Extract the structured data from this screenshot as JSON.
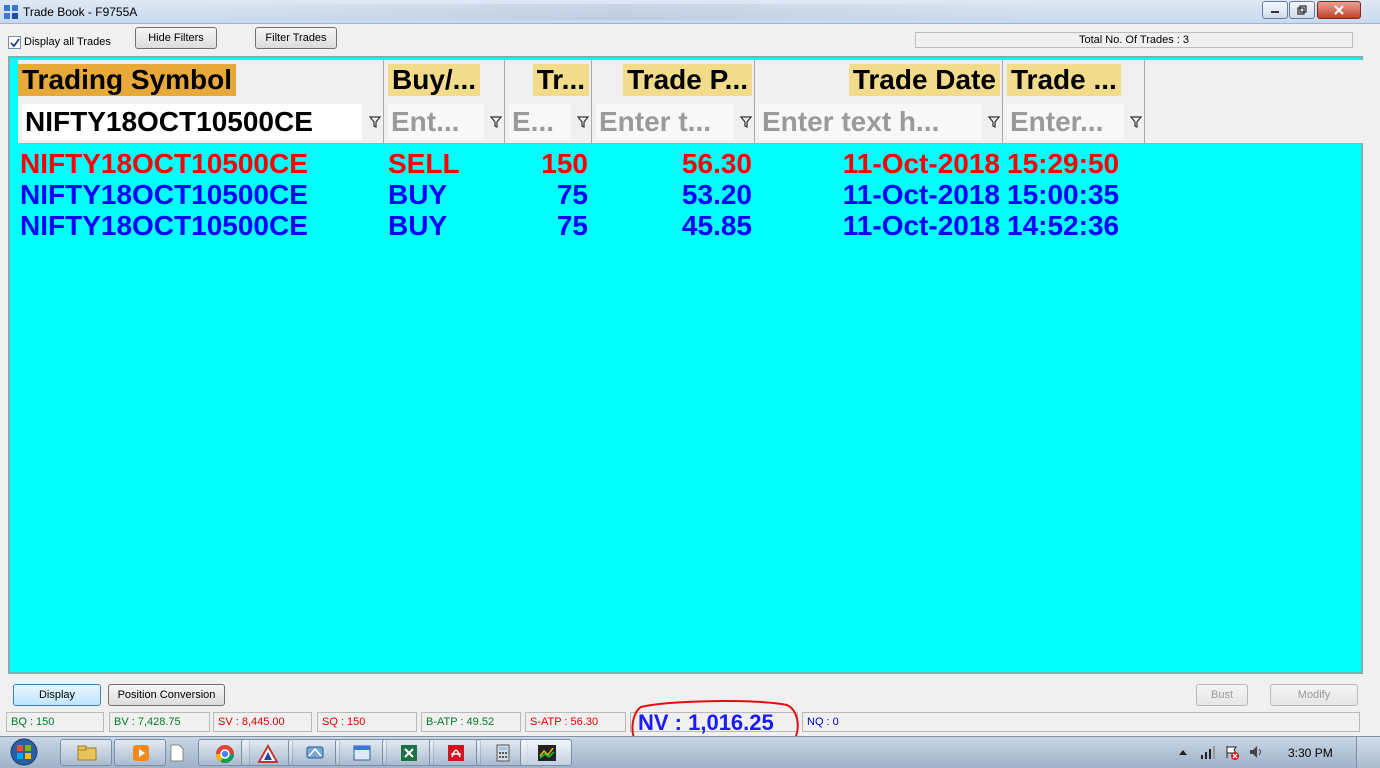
{
  "window": {
    "title": "Trade Book - F9755A"
  },
  "toolbar": {
    "display_all_label": "Display all Trades",
    "display_all_checked": true,
    "hide_filters_label": "Hide Filters",
    "filter_trades_label": "Filter Trades",
    "total_trades_text": "Total No. Of Trades : 3"
  },
  "grid": {
    "columns": [
      {
        "header": "Trading Symbol",
        "filter": "NIFTY18OCT10500CE",
        "filter_is_placeholder": false
      },
      {
        "header": "Buy/...",
        "filter": "Ent...",
        "filter_is_placeholder": true
      },
      {
        "header": "Tr...",
        "filter": "E...",
        "filter_is_placeholder": true
      },
      {
        "header": "Trade P...",
        "filter": "Enter t...",
        "filter_is_placeholder": true
      },
      {
        "header": "Trade Date",
        "filter": "Enter text h...",
        "filter_is_placeholder": true
      },
      {
        "header": "Trade ...",
        "filter": "Enter...",
        "filter_is_placeholder": true
      }
    ],
    "rows": [
      {
        "side": "sell",
        "symbol": "NIFTY18OCT10500CE",
        "buy_sell": "SELL",
        "qty": "150",
        "price": "56.30",
        "date": "11-Oct-2018",
        "time": "15:29:50"
      },
      {
        "side": "buy",
        "symbol": "NIFTY18OCT10500CE",
        "buy_sell": "BUY",
        "qty": "75",
        "price": "53.20",
        "date": "11-Oct-2018",
        "time": "15:00:35"
      },
      {
        "side": "buy",
        "symbol": "NIFTY18OCT10500CE",
        "buy_sell": "BUY",
        "qty": "75",
        "price": "45.85",
        "date": "11-Oct-2018",
        "time": "14:52:36"
      }
    ],
    "colors": {
      "sell": "#ff0000",
      "buy": "#0000ff",
      "background": "#00ffff"
    }
  },
  "actions": {
    "display_label": "Display",
    "position_conversion_label": "Position Conversion",
    "bust_label": "Bust",
    "modify_label": "Modify"
  },
  "status": {
    "bq": "BQ : 150",
    "bv": "BV : 7,428.75",
    "sv": "SV : 8,445.00",
    "sq": "SQ : 150",
    "batp": "B-ATP : 49.52",
    "satp": "S-ATP : 56.30",
    "nv": "NV : 1,016.25",
    "nq": "NQ : 0"
  },
  "taskbar": {
    "clock": "3:30 PM",
    "apps": [
      "explorer-icon",
      "media-player-icon",
      "notepad-icon",
      "chrome-icon",
      "app-triangle-icon",
      "app-network-icon",
      "app-window-icon",
      "excel-icon",
      "acrobat-icon",
      "calculator-icon",
      "chart-app-icon"
    ]
  }
}
